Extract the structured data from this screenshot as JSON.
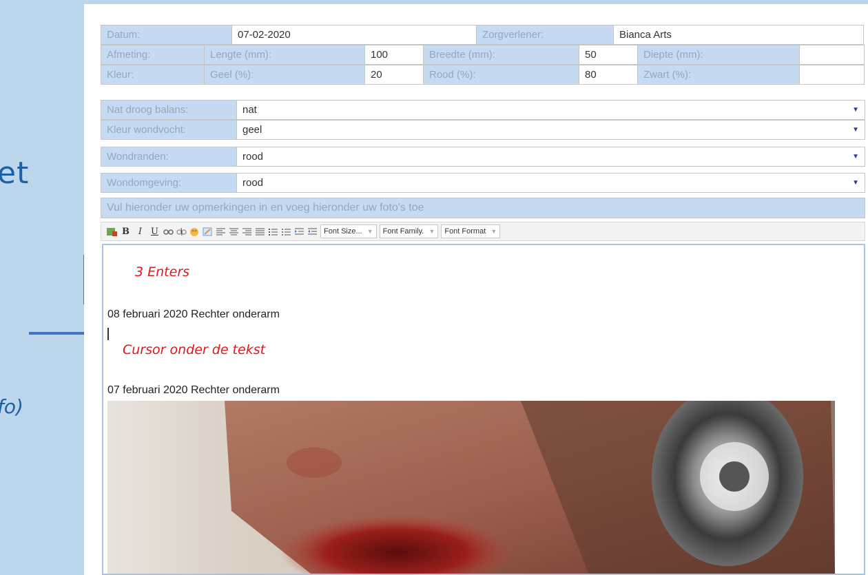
{
  "slide": {
    "fragment_top": "et",
    "fragment_bottom": "fo)"
  },
  "form": {
    "row1": {
      "datum_label": "Datum:",
      "datum_value": "07-02-2020",
      "zorg_label": "Zorgverlener:",
      "zorg_value": "Bianca Arts"
    },
    "row2": {
      "label": "Afmeting:",
      "lengte_label": "Lengte (mm):",
      "lengte_value": "100",
      "breedte_label": "Breedte (mm):",
      "breedte_value": "50",
      "diepte_label": "Diepte (mm):",
      "diepte_value": ""
    },
    "row3": {
      "label": "Kleur:",
      "geel_label": "Geel (%):",
      "geel_value": "20",
      "rood_label": "Rood (%):",
      "rood_value": "80",
      "zwart_label": "Zwart (%):",
      "zwart_value": ""
    },
    "selects": [
      {
        "label": "Nat droog balans:",
        "value": "nat"
      },
      {
        "label": "Kleur wondvocht:",
        "value": "geel"
      },
      {
        "label": "Wondranden:",
        "value": "rood"
      },
      {
        "label": "Wondomgeving:",
        "value": "rood"
      }
    ],
    "banner": "Vul hieronder uw opmerkingen in en voeg hieronder uw foto's toe"
  },
  "toolbar": {
    "bold": "B",
    "italic": "I",
    "underline": "U",
    "font_size": "Font Size...",
    "font_family": "Font Family.",
    "font_format": "Font Format"
  },
  "editor": {
    "note_enters": "3 Enters",
    "line1": "08 februari 2020 Rechter onderarm",
    "note_cursor": "Cursor onder de tekst",
    "line2": "07 februari 2020  Rechter onderarm"
  },
  "colors": {
    "accent": "#4472c4",
    "annotation": "#e01818",
    "label_bg": "#c6daf2"
  }
}
